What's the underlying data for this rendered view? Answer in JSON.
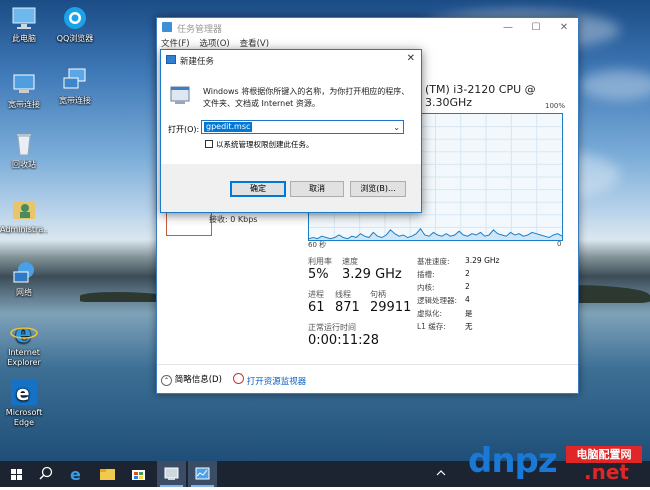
{
  "desktop": {
    "icons": [
      {
        "label": "此电脑",
        "icon": "computer-icon"
      },
      {
        "label": "QQ浏览器",
        "icon": "qq-browser-icon"
      },
      {
        "label": "宽带连接",
        "icon": "broadband-icon"
      },
      {
        "label": "宽带连接",
        "icon": "network-connection-icon"
      },
      {
        "label": "回收站",
        "icon": "recycle-bin-icon"
      },
      {
        "label": "Administra...",
        "icon": "user-folder-icon"
      },
      {
        "label": "网络",
        "icon": "network-icon"
      },
      {
        "label": "Internet Explorer",
        "icon": "ie-icon"
      },
      {
        "label": "Microsoft Edge",
        "icon": "edge-icon"
      }
    ]
  },
  "task_manager": {
    "title": "任务管理器",
    "menu": [
      "文件(F)",
      "选项(O)",
      "查看(V)"
    ],
    "cpu_title": "(TM) i3-2120 CPU @ 3.30GHz",
    "graph_max": "100%",
    "graph_seconds": "60 秒",
    "graph_zero": "0",
    "network": "0 Kbps",
    "network_send_recv": "接收: 0 Kbps",
    "stats": {
      "utilization_label": "利用率",
      "utilization": "5%",
      "speed_label": "速度",
      "speed": "3.29 GHz",
      "processes_label": "进程",
      "processes": "61",
      "threads_label": "线程",
      "threads": "871",
      "handles_label": "句柄",
      "handles": "29911",
      "uptime_label": "正常运行时间",
      "uptime": "0:00:11:28"
    },
    "side": [
      {
        "label": "基准速度:",
        "value": "3.29 GHz"
      },
      {
        "label": "插槽:",
        "value": "2"
      },
      {
        "label": "内核:",
        "value": "2"
      },
      {
        "label": "逻辑处理器:",
        "value": "4"
      },
      {
        "label": "虚拟化:",
        "value": "是"
      },
      {
        "label": "L1 缓存:",
        "value": "无"
      }
    ],
    "footer": {
      "fewer_details": "简略信息(D)",
      "open_monitor": "打开资源监视器"
    },
    "cpu_history": [
      1,
      2,
      1,
      3,
      2,
      1,
      2,
      4,
      2,
      1,
      3,
      2,
      5,
      3,
      2,
      6,
      3,
      2,
      4,
      8,
      5,
      3,
      4,
      2,
      3,
      5,
      9,
      4,
      3,
      6,
      4,
      3,
      5,
      3,
      4,
      7,
      4,
      3,
      5,
      4,
      6,
      3,
      4,
      8,
      5,
      4,
      3,
      6,
      4,
      5,
      3,
      4,
      6,
      5,
      4,
      3,
      2,
      4,
      5,
      3
    ]
  },
  "run_dialog": {
    "title": "新建任务",
    "description": "Windows 将根据你所键入的名称，为你打开相应的程序、文件夹、文档或 Internet 资源。",
    "open_label": "打开(O):",
    "input_value": "gpedit.msc",
    "admin_checkbox_label": "以系统管理权限创建此任务。",
    "admin_checked": false,
    "ok_label": "确定",
    "cancel_label": "取消",
    "browse_label": "浏览(B)..."
  },
  "taskbar": {
    "items": [
      "start-icon",
      "search-icon",
      "edge-icon",
      "file-explorer-icon",
      "store-icon",
      "network-manager-icon",
      "task-manager-icon"
    ]
  },
  "watermark": {
    "dn": "dn",
    "pz": "pz",
    "cn": "电脑配置网",
    "net": ".net"
  }
}
